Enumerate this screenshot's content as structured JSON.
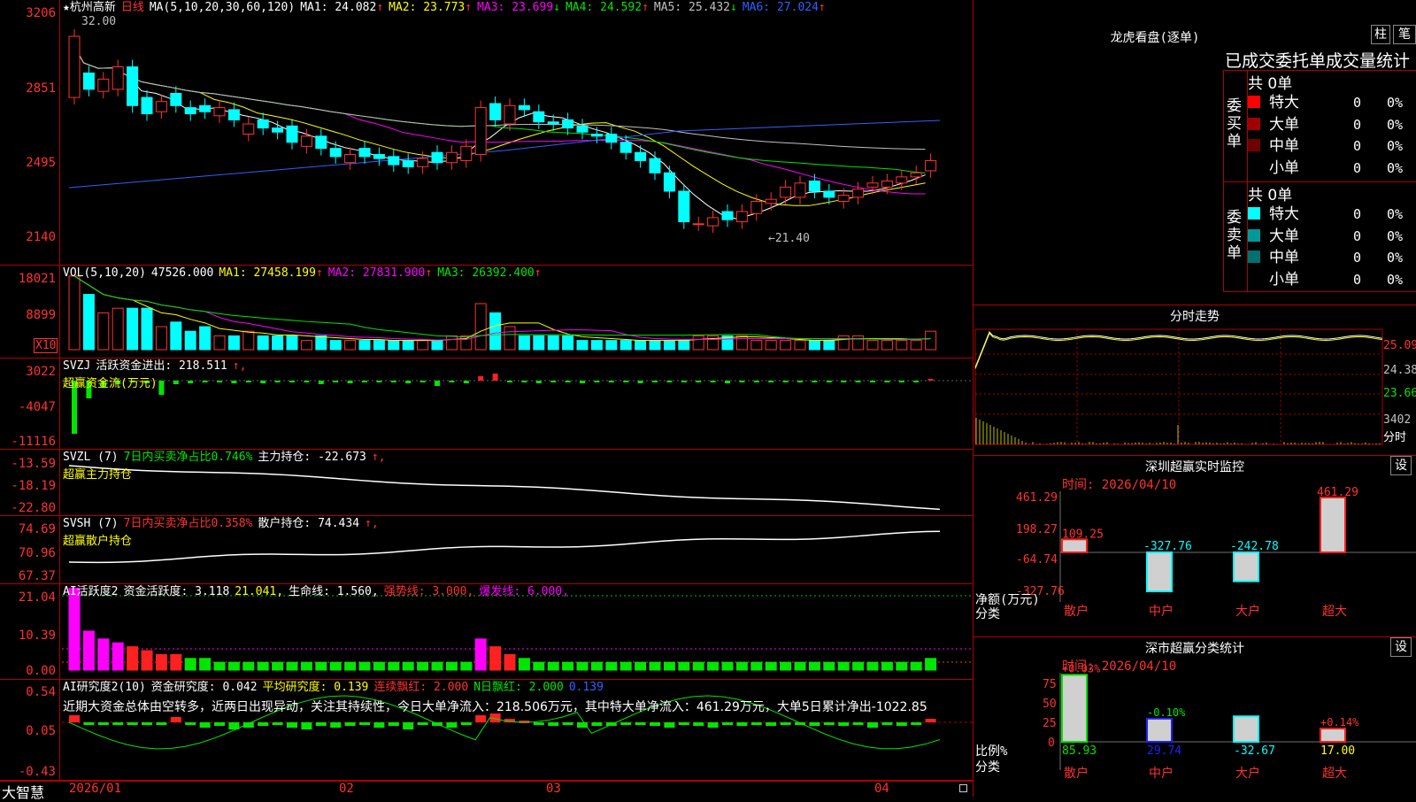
{
  "main": {
    "title": "★杭州高新",
    "period": "日线",
    "ma_label": "MA(5,10,20,30,60,120)",
    "ma": [
      {
        "label": "MA1: 24.082",
        "arrow": "↑",
        "color": "#ffffff"
      },
      {
        "label": "MA2: 23.773",
        "arrow": "↑",
        "color": "#ffff00"
      },
      {
        "label": "MA3: 23.699",
        "arrow": "↓",
        "color": "#ff00ff"
      },
      {
        "label": "MA4: 24.592",
        "arrow": "↑",
        "color": "#00e600"
      },
      {
        "label": "MA5: 25.432",
        "arrow": "↓",
        "color": "#c0c0c0"
      },
      {
        "label": "MA6: 27.024",
        "arrow": "↑",
        "color": "#3060ff"
      }
    ],
    "y_labels": [
      "3206",
      "2851",
      "2495",
      "2140"
    ],
    "high_marker": "32.00",
    "low_marker": "←21.40"
  },
  "vol": {
    "label": "VOL(5,10,20)",
    "value": "47526.000",
    "ma": [
      {
        "label": "MA1: 27458.199",
        "color": "#ffff00"
      },
      {
        "label": "MA2: 27831.900",
        "color": "#ff00ff"
      },
      {
        "label": "MA3: 26392.400",
        "color": "#00e600"
      }
    ],
    "y_labels": [
      "18021",
      "8899"
    ],
    "unit": "X10"
  },
  "svzj": {
    "label": "SVZJ",
    "line1": "活跃资金进出: 218.511",
    "line2": "超赢资金流(万元)",
    "y_labels": [
      "3022",
      "-4047",
      "-11116"
    ]
  },
  "svzl": {
    "label": "SVZL (7)",
    "pct": "7日内买卖净占比0.746%",
    "value": "主力持仓: -22.673",
    "line2": "超赢主力持仓",
    "y_labels": [
      "-13.59",
      "-18.19",
      "-22.80"
    ]
  },
  "svsh": {
    "label": "SVSH (7)",
    "pct": "7日内买卖净占比0.358%",
    "value": "散户持仓: 74.434",
    "line2": "超赢散户持仓",
    "y_labels": [
      "74.69",
      "70.96",
      "67.37"
    ]
  },
  "ai1": {
    "label": "AI活跃度2",
    "v1": "资金活跃度: 3.118",
    "v2": "21.041,",
    "v3": "生命线: 1.560,",
    "v4": "强势线: 3.000,",
    "v5": "爆发线: 6.000,",
    "y_labels": [
      "21.04",
      "10.39",
      "0.00"
    ]
  },
  "ai2": {
    "label": "AI研究度2(10)",
    "v1": "资金研究度: 0.042",
    "v2": "平均研究度: 0.139",
    "v3": "连续飘红: 2.000",
    "v4": "N日飘红: 2.000",
    "v5": "0.139",
    "text": "近期大资金总体由空转多，近两日出现异动，关注其持续性，今日大单净流入：218.506万元，其中特大单净流入：461.29万元，大单5日累计净出-1022.85",
    "y_labels": [
      "0.54",
      "0.05",
      "-0.43"
    ]
  },
  "footer": {
    "brand": "大智慧",
    "dates": [
      "2026/01",
      "02",
      "03",
      "04"
    ]
  },
  "dragon": {
    "title": "龙虎看盘(逐单)",
    "btn1": "柱",
    "btn2": "笔",
    "heading": "已成交委托单成交量统计",
    "buy": {
      "label": "委买单",
      "total": "共 0单",
      "rows": [
        {
          "name": "特大",
          "count": "0",
          "pct": "0%",
          "color": "#ff0000"
        },
        {
          "name": "大单",
          "count": "0",
          "pct": "0%",
          "color": "#a00000"
        },
        {
          "name": "中单",
          "count": "0",
          "pct": "0%",
          "color": "#700000"
        },
        {
          "name": "小单",
          "count": "0",
          "pct": "0%",
          "color": "#000000"
        }
      ]
    },
    "sell": {
      "label": "委卖单",
      "total": "共 0单",
      "rows": [
        {
          "name": "特大",
          "count": "0",
          "pct": "0%",
          "color": "#00ffff"
        },
        {
          "name": "大单",
          "count": "0",
          "pct": "0%",
          "color": "#009999"
        },
        {
          "name": "中单",
          "count": "0",
          "pct": "0%",
          "color": "#007070"
        },
        {
          "name": "小单",
          "count": "0",
          "pct": "0%",
          "color": "#000000"
        }
      ]
    }
  },
  "intraday": {
    "title": "分时走势",
    "labels": [
      "25.09",
      "24.38",
      "23.66",
      "3402",
      "分时"
    ]
  },
  "monitor": {
    "title": "深圳超赢实时监控",
    "btn": "设",
    "time": "时间: 2026/04/10",
    "y_labels": [
      "461.29",
      "198.27",
      "-64.74",
      "-327.76"
    ],
    "ylabel1": "净额(万元)",
    "ylabel2": "分类",
    "categories": [
      "散户",
      "中户",
      "大户",
      "超大"
    ],
    "values": [
      "109.25",
      "-327.76",
      "-242.78",
      "461.29"
    ]
  },
  "classify": {
    "title": "深市超赢分类统计",
    "btn": "设",
    "time": "时间: 2026/04/10",
    "y_labels": [
      "75",
      "50",
      "25",
      "0"
    ],
    "ylabel1": "比例%",
    "ylabel2": "分类",
    "categories": [
      "散户",
      "中户",
      "大户",
      "超大"
    ],
    "top_labels": [
      "+0.03%",
      "-0.10%",
      "",
      "+0.14%"
    ],
    "values": [
      "85.93",
      "29.74",
      "-32.67",
      "17.00"
    ]
  }
}
